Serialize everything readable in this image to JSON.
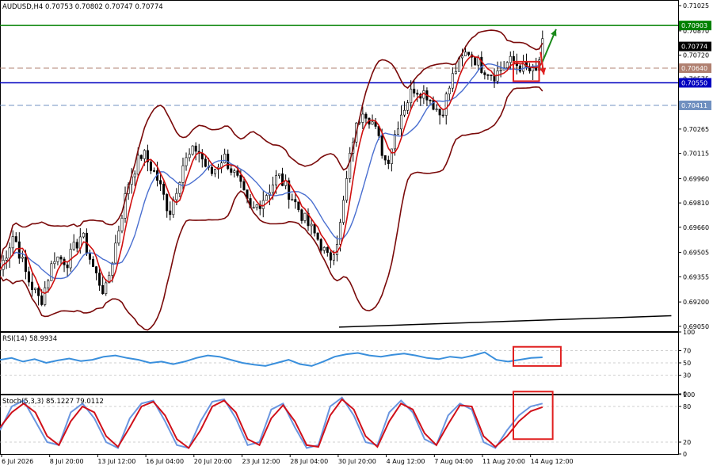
{
  "chart_data": [
    {
      "type": "candlestick",
      "header": {
        "symbol": "AUDUSD,H4",
        "ohlc": [
          "0.70753",
          "0.70802",
          "0.70747",
          "0.70774"
        ]
      },
      "y_ticks": [
        "0.71025",
        "0.70870",
        "0.70720",
        "0.70575",
        "0.70425",
        "0.70265",
        "0.70115",
        "0.69960",
        "0.69810",
        "0.69660",
        "0.69505",
        "0.69355",
        "0.69200",
        "0.69050"
      ],
      "y_tick_values": [
        0.71025,
        0.7087,
        0.7072,
        0.70575,
        0.70425,
        0.70265,
        0.70115,
        0.6996,
        0.6981,
        0.6966,
        0.69505,
        0.69355,
        0.692,
        0.6905
      ],
      "ylim": [
        0.6902,
        0.7106
      ],
      "x_labels": [
        "6 Jul 2026",
        "8 Jul 20:00",
        "13 Jul 12:00",
        "16 Jul 04:00",
        "20 Jul 20:00",
        "23 Jul 12:00",
        "28 Jul 04:00",
        "30 Jul 20:00",
        "4 Aug 12:00",
        "7 Aug 04:00",
        "11 Aug 20:00",
        "14 Aug 12:00"
      ],
      "levels": [
        {
          "label": "0.70903",
          "value": 0.70903,
          "color": "#008000",
          "style": "solid"
        },
        {
          "label": "0.70774",
          "value": 0.70774,
          "color": "#000000",
          "style": "tag"
        },
        {
          "label": "0.70640",
          "value": 0.7064,
          "color": "#b08070",
          "style": "dashed"
        },
        {
          "label": "0.70550",
          "value": 0.7055,
          "color": "#0000c0",
          "style": "solid"
        },
        {
          "label": "0.70411",
          "value": 0.70411,
          "color": "#7090c0",
          "style": "dashed"
        }
      ],
      "trendline": {
        "from": [
          0.5,
          0.69045
        ],
        "to": [
          0.99,
          0.69115
        ]
      },
      "price_path": [
        [
          0.0,
          0.694
        ],
        [
          0.02,
          0.6962
        ],
        [
          0.04,
          0.6935
        ],
        [
          0.06,
          0.692
        ],
        [
          0.08,
          0.6948
        ],
        [
          0.1,
          0.6945
        ],
        [
          0.12,
          0.6962
        ],
        [
          0.14,
          0.6938
        ],
        [
          0.155,
          0.6925
        ],
        [
          0.17,
          0.6955
        ],
        [
          0.19,
          0.6995
        ],
        [
          0.21,
          0.7012
        ],
        [
          0.23,
          0.6998
        ],
        [
          0.25,
          0.6975
        ],
        [
          0.27,
          0.7005
        ],
        [
          0.29,
          0.7015
        ],
        [
          0.31,
          0.6998
        ],
        [
          0.33,
          0.701
        ],
        [
          0.35,
          0.6995
        ],
        [
          0.37,
          0.6975
        ],
        [
          0.39,
          0.6985
        ],
        [
          0.41,
          0.6998
        ],
        [
          0.43,
          0.6985
        ],
        [
          0.45,
          0.697
        ],
        [
          0.47,
          0.6958
        ],
        [
          0.485,
          0.6945
        ],
        [
          0.5,
          0.6962
        ],
        [
          0.52,
          0.702
        ],
        [
          0.535,
          0.704
        ],
        [
          0.55,
          0.703
        ],
        [
          0.57,
          0.7005
        ],
        [
          0.59,
          0.7035
        ],
        [
          0.61,
          0.7052
        ],
        [
          0.63,
          0.7048
        ],
        [
          0.65,
          0.7035
        ],
        [
          0.67,
          0.7062
        ],
        [
          0.69,
          0.7075
        ],
        [
          0.71,
          0.7065
        ],
        [
          0.73,
          0.706
        ],
        [
          0.75,
          0.7068
        ],
        [
          0.77,
          0.7065
        ],
        [
          0.79,
          0.706
        ],
        [
          0.8,
          0.7078
        ]
      ],
      "arrows": [
        {
          "color": "#1a8a1a",
          "from": [
            0.8,
            0.7068
          ],
          "to": [
            0.82,
            0.7088
          ]
        },
        {
          "color": "#e02020",
          "from": [
            0.797,
            0.7074
          ],
          "to": [
            0.802,
            0.706
          ]
        }
      ],
      "highlight_box": {
        "x": [
          0.757,
          0.795
        ],
        "y": [
          0.7068,
          0.7056
        ]
      }
    },
    {
      "type": "line",
      "title": "RSI(14) 58.9934",
      "y_ticks": [
        "100",
        "70",
        "50",
        "30",
        "0"
      ],
      "y_tick_values": [
        100,
        70,
        50,
        30,
        0
      ],
      "ylim": [
        0,
        100
      ],
      "series": [
        {
          "color": "#3a8fdc",
          "values": [
            55,
            58,
            52,
            56,
            50,
            54,
            57,
            53,
            55,
            60,
            62,
            58,
            55,
            50,
            52,
            48,
            52,
            58,
            62,
            60,
            55,
            50,
            47,
            45,
            50,
            55,
            48,
            45,
            52,
            60,
            64,
            66,
            62,
            60,
            63,
            65,
            62,
            58,
            56,
            60,
            58,
            62,
            67,
            55,
            52,
            55,
            58,
            59
          ]
        }
      ],
      "highlight_box": {
        "x": [
          0.757,
          0.827
        ],
        "y": [
          76,
          45
        ]
      }
    },
    {
      "type": "line",
      "title": "Stoch(5,3,3) 85.1227 79.0112",
      "y_ticks": [
        "100",
        "80",
        "20",
        "0"
      ],
      "y_tick_values": [
        100,
        80,
        20,
        0
      ],
      "ylim": [
        0,
        100
      ],
      "series": [
        {
          "color": "#6a96e0",
          "values": [
            40,
            80,
            90,
            55,
            20,
            15,
            70,
            85,
            60,
            20,
            10,
            60,
            85,
            90,
            55,
            15,
            10,
            55,
            88,
            92,
            60,
            15,
            20,
            75,
            85,
            45,
            10,
            15,
            80,
            95,
            65,
            20,
            15,
            70,
            90,
            70,
            25,
            15,
            65,
            85,
            75,
            20,
            10,
            40,
            65,
            80,
            85
          ]
        },
        {
          "color": "#d0101a",
          "values": [
            45,
            70,
            85,
            70,
            30,
            15,
            55,
            80,
            70,
            30,
            12,
            45,
            80,
            88,
            65,
            25,
            10,
            40,
            80,
            90,
            70,
            25,
            15,
            60,
            82,
            55,
            15,
            12,
            65,
            92,
            75,
            30,
            12,
            55,
            85,
            75,
            35,
            15,
            50,
            82,
            80,
            30,
            12,
            30,
            55,
            72,
            79
          ]
        }
      ],
      "highlight_box": {
        "x": [
          0.757,
          0.815
        ],
        "y": [
          105,
          25
        ]
      }
    }
  ]
}
